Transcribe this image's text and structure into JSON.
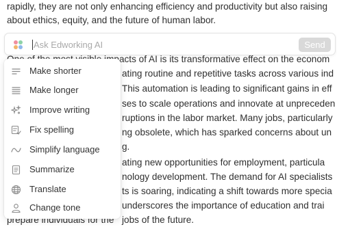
{
  "document": {
    "lines": [
      "rapidly, they are not only enhancing efficiency and productivity but also raising",
      "about ethics, equity, and the future of human labor."
    ],
    "line3_underlined_start": "One of the most visible im",
    "line3_rest": "pacts of AI is its transformative effect on the econom",
    "right_fragments": [
      "ating routine and repetitive tasks across various ind",
      "This automation is leading to significant gains in eff",
      "ses to scale operations and innovate at unpreceden",
      "ruptions in the labor market. Many jobs, particularly",
      "ng obsolete, which has sparked concerns about un",
      "g.",
      "ating new opportunities for employment, particula",
      "nology development. The demand for AI specialists",
      "ts is soaring, indicating a shift towards more specia",
      "underscores the importance of education and trai"
    ],
    "bottom_line_hidden": "prepare individuals for the",
    "bottom_line_visible": "jobs of the future."
  },
  "ask_bar": {
    "placeholder": "Ask Edworking AI",
    "value": "",
    "send_label": "Send",
    "sparkle_colors": [
      "#f08fa0",
      "#8fd3a8",
      "#f2b46b",
      "#8fb8ec"
    ]
  },
  "menu": {
    "items": [
      {
        "label": "Make shorter",
        "icon": "lines-short-icon"
      },
      {
        "label": "Make longer",
        "icon": "lines-long-icon"
      },
      {
        "label": "Improve writing",
        "icon": "sparkles-icon"
      },
      {
        "label": "Fix spelling",
        "icon": "spellcheck-icon"
      },
      {
        "label": "Simplify language",
        "icon": "wave-icon"
      },
      {
        "label": "Summarize",
        "icon": "document-icon"
      },
      {
        "label": "Translate",
        "icon": "globe-icon"
      },
      {
        "label": "Change tone",
        "icon": "person-icon"
      }
    ]
  },
  "colors": {
    "text": "#2f2f2f",
    "send_disabled": "#d9d9d9",
    "menu_icon": "#8a8a8a"
  }
}
